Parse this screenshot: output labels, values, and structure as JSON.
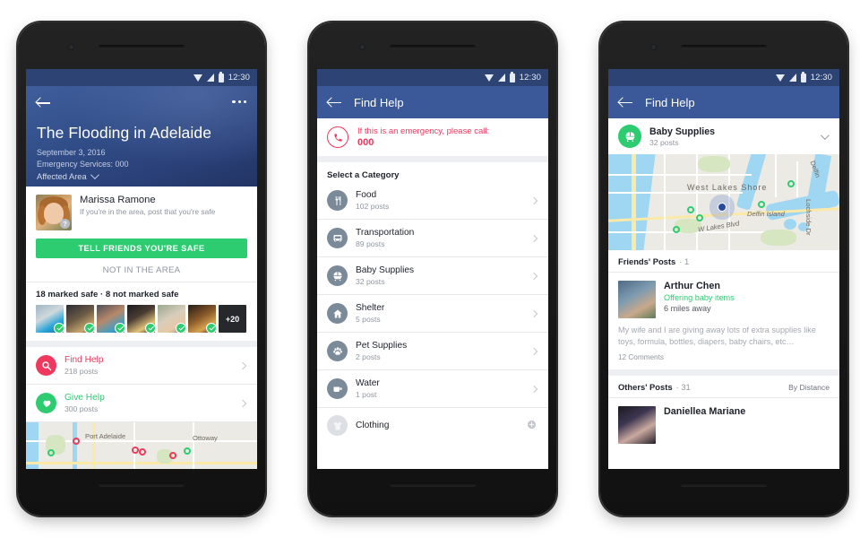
{
  "meta": {
    "status_time": "12:30"
  },
  "phone1": {
    "appbar": {
      "back": "back-arrow",
      "more": "more-options"
    },
    "hero": {
      "title": "The Flooding in Adelaide",
      "date": "September 3, 2016",
      "emergency_line": "Emergency Services: 000",
      "affected_area": "Affected Area"
    },
    "safety": {
      "name": "Marissa Ramone",
      "prompt": "If you're in the area, post that you're safe",
      "badge": "?",
      "primary_button": "TELL FRIENDS YOU'RE SAFE",
      "secondary_button": "NOT IN THE AREA",
      "marked_summary": "18 marked safe · 8 not marked safe",
      "overflow_count": "+20"
    },
    "actions": [
      {
        "label": "Find Help",
        "posts": "218 posts",
        "color": "#f0385f",
        "icon": "search-icon"
      },
      {
        "label": "Give Help",
        "posts": "300 posts",
        "color": "#2ecc71",
        "icon": "heart-icon"
      }
    ],
    "map": {
      "labels": [
        "Port Adelaide",
        "Ottoway"
      ]
    }
  },
  "phone2": {
    "appbar": {
      "title": "Find Help"
    },
    "emergency": {
      "text": "If this is an emergency, please call:",
      "number": "000",
      "icon": "phone-icon"
    },
    "section_label": "Select a Category",
    "categories": [
      {
        "label": "Food",
        "posts": "102 posts",
        "icon": "utensils-icon",
        "state": "active"
      },
      {
        "label": "Transportation",
        "posts": "89 posts",
        "icon": "bus-icon",
        "state": "active"
      },
      {
        "label": "Baby Supplies",
        "posts": "32 posts",
        "icon": "stroller-icon",
        "state": "active"
      },
      {
        "label": "Shelter",
        "posts": "5 posts",
        "icon": "home-icon",
        "state": "active"
      },
      {
        "label": "Pet Supplies",
        "posts": "2 posts",
        "icon": "paw-icon",
        "state": "active"
      },
      {
        "label": "Water",
        "posts": "1 post",
        "icon": "cup-icon",
        "state": "active"
      },
      {
        "label": "Clothing",
        "posts": "",
        "icon": "shirt-icon",
        "state": "empty"
      }
    ]
  },
  "phone3": {
    "appbar": {
      "title": "Find Help"
    },
    "category": {
      "label": "Baby Supplies",
      "posts": "32 posts",
      "icon": "stroller-icon"
    },
    "map": {
      "labels": [
        "West Lakes Shore",
        "Delfin Island",
        "W Lakes Blvd",
        "Lochside Dr",
        "Delfin"
      ]
    },
    "friends_section": {
      "label": "Friends' Posts",
      "count": "· 1"
    },
    "friend_post": {
      "name": "Arthur Chen",
      "offer": "Offering baby items",
      "distance": "6 miles away",
      "body": "My wife and I are giving away lots of extra supplies like toys, formula, bottles, diapers, baby chairs, etc…",
      "comments": "12 Comments"
    },
    "others_section": {
      "label": "Others' Posts",
      "count": "· 31",
      "sort": "By Distance"
    },
    "other_post": {
      "name": "Daniellea Mariane"
    }
  },
  "colors": {
    "fb_blue": "#3b5998",
    "status_blue": "#2c4373",
    "green": "#2ecc71",
    "red": "#f0385f",
    "slate": "#7b8a99",
    "slate_light": "#dcdfe3"
  }
}
